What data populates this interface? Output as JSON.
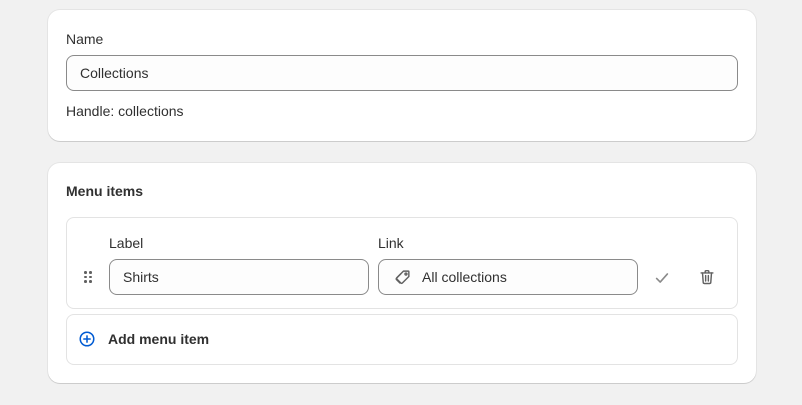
{
  "name_card": {
    "name_label": "Name",
    "name_value": "Collections",
    "handle_text": "Handle: collections"
  },
  "menu_card": {
    "title": "Menu items",
    "item": {
      "label_heading": "Label",
      "link_heading": "Link",
      "label_value": "Shirts",
      "link_value": "All collections"
    },
    "add_label": "Add menu item"
  },
  "icons": {
    "drag": "drag-handle-icon",
    "link_type": "tag-icon",
    "confirm": "checkmark-icon",
    "delete": "trash-icon",
    "add": "plus-circle-icon"
  },
  "colors": {
    "background": "#f1f1f1",
    "card": "#ffffff",
    "text": "#303030",
    "input_border": "#8a8a8a",
    "accent_blue": "#005bd3",
    "muted_icon": "#8a8a8a"
  }
}
